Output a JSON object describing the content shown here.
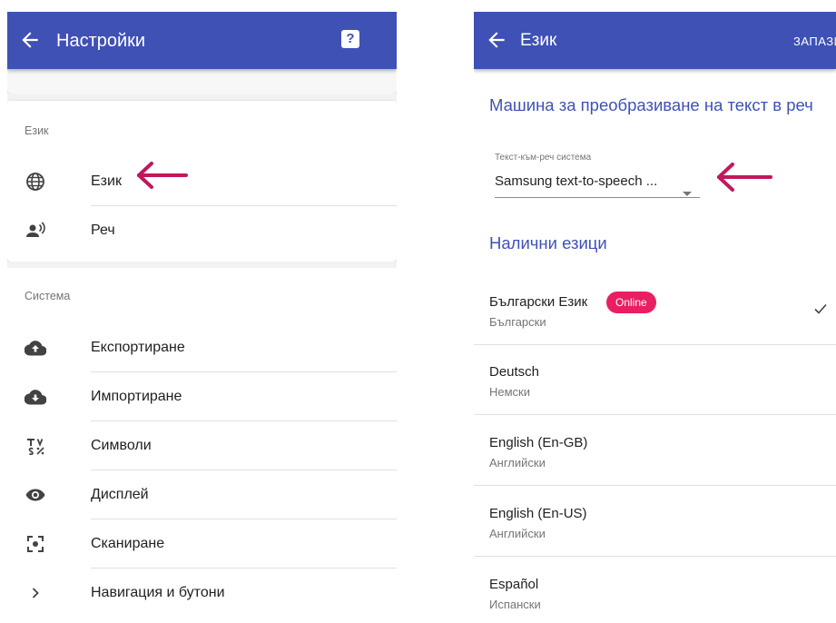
{
  "colors": {
    "primary": "#3f51b5",
    "accent": "#e91e63",
    "arrow": "#c2185b"
  },
  "left": {
    "appbar": {
      "title": "Настройки",
      "back_icon": "arrow-left-icon",
      "help_icon": "help-icon",
      "help_glyph": "?"
    },
    "sections": [
      {
        "label": "Език",
        "items": [
          {
            "label": "Език",
            "icon": "globe-icon"
          },
          {
            "label": "Реч",
            "icon": "speaker-person-icon"
          }
        ]
      },
      {
        "label": "Система",
        "items": [
          {
            "label": "Експортиране",
            "icon": "cloud-upload-icon"
          },
          {
            "label": "Импортиране",
            "icon": "cloud-download-icon"
          },
          {
            "label": "Символи",
            "icon": "symbols-icon"
          },
          {
            "label": "Дисплей",
            "icon": "eye-icon"
          },
          {
            "label": "Сканиране",
            "icon": "scan-icon"
          },
          {
            "label": "Навигация и бутони",
            "icon": "chevron-right-icon"
          }
        ]
      }
    ]
  },
  "right": {
    "appbar": {
      "title": "Език",
      "action": "ЗАПАЗИ",
      "back_icon": "arrow-left-icon"
    },
    "tts_heading": "Машина за преобразиване на текст в реч",
    "tts_field": {
      "label": "Текст-към-реч система",
      "value": "Samsung text-to-speech ..."
    },
    "available_heading": "Налични езици",
    "languages": [
      {
        "name": "Български Език",
        "native": "Български",
        "badge": "Online",
        "selected": true
      },
      {
        "name": "Deutsch",
        "native": "Немски",
        "selected": false
      },
      {
        "name": "English (En-GB)",
        "native": "Английски",
        "selected": false
      },
      {
        "name": "English (En-US)",
        "native": "Английски",
        "selected": false
      },
      {
        "name": "Español",
        "native": "Испански",
        "selected": false
      }
    ]
  }
}
